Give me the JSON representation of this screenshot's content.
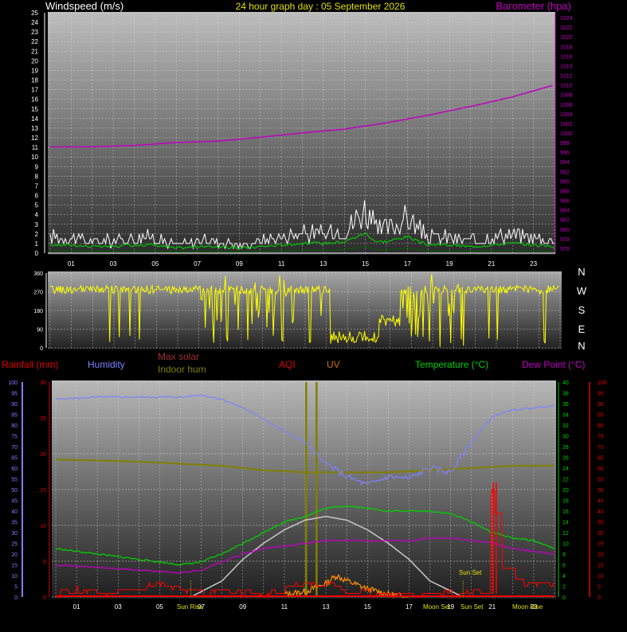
{
  "header": {
    "left_title": "Windspeed (m/s)",
    "center_title": "24 hour graph day : 05 September 2026",
    "right_title": "Barometer (hpa)"
  },
  "bottom_legend": {
    "rainfall": "Rainfall (mm)",
    "humidity": "Humidity",
    "max_solar": "Max solar",
    "indoor_hum": "Indoor hum",
    "aqi": "AQI",
    "uv": "UV",
    "temperature": "Temperature (°C)",
    "dew_point": "Dew Point (°C)"
  },
  "colors": {
    "windspeed": "#ffffff",
    "gust_avg": "#00c800",
    "barometer": "#c000c0",
    "direction": "#ffff00",
    "humidity": "#8080ff",
    "indoor_hum": "#808000",
    "temperature": "#00d000",
    "dew_point": "#c000c0",
    "rainfall": "#ff0000",
    "solar": "#ff9000",
    "max_solar": "#c8c8c8",
    "uv": "#808000"
  },
  "chart_data": [
    {
      "type": "line",
      "name": "wind_and_barometer",
      "x_ticks": [
        "01",
        "03",
        "05",
        "07",
        "09",
        "11",
        "13",
        "15",
        "17",
        "19",
        "21",
        "23"
      ],
      "y_left": {
        "label": "Windspeed (m/s)",
        "range": [
          0,
          25
        ],
        "ticks": [
          0,
          1,
          2,
          3,
          4,
          5,
          6,
          7,
          8,
          9,
          10,
          11,
          12,
          13,
          14,
          15,
          16,
          17,
          18,
          19,
          20,
          21,
          22,
          23,
          24,
          25
        ]
      },
      "y_right": {
        "label": "Barometer (hpa)",
        "range": [
          975,
          1025
        ],
        "ticks": [
          976,
          978,
          980,
          982,
          984,
          986,
          988,
          990,
          992,
          994,
          996,
          998,
          1000,
          1002,
          1004,
          1006,
          1008,
          1010,
          1012,
          1014,
          1016,
          1018,
          1020,
          1022,
          1024
        ]
      },
      "series": [
        {
          "name": "Barometer (hpa)",
          "x": [
            0,
            2,
            4,
            6,
            8,
            10,
            12,
            14,
            16,
            18,
            20,
            22,
            24
          ],
          "values": [
            997.1,
            997.1,
            997.4,
            998.0,
            998.3,
            999.1,
            1000.0,
            1000.8,
            1002.1,
            1003.7,
            1005.5,
            1007.5,
            1010.0
          ]
        },
        {
          "name": "Windspeed (m/s)",
          "x": [
            0,
            1,
            2,
            3,
            4,
            5,
            6,
            7,
            8,
            9,
            10,
            11,
            12,
            13,
            14,
            15,
            15.5,
            16,
            17,
            17.5,
            18,
            19,
            20,
            21,
            22,
            23,
            24
          ],
          "values": [
            2,
            2,
            1.5,
            1.5,
            2,
            2,
            1,
            1.5,
            1.5,
            1,
            1.5,
            2,
            2.5,
            2.5,
            3,
            5.5,
            3,
            3,
            4.5,
            3,
            2,
            2,
            1.5,
            2,
            2.5,
            2,
            1.5
          ]
        }
      ]
    },
    {
      "type": "line",
      "name": "wind_direction",
      "y_ticks": [
        0,
        90,
        180,
        270,
        360
      ],
      "compass_labels": [
        "N",
        "W",
        "S",
        "E",
        "N"
      ]
    },
    {
      "type": "line",
      "name": "temperature_humidity",
      "x_ticks": [
        "01",
        "03",
        "05",
        "07",
        "09",
        "11",
        "13",
        "15",
        "17",
        "19",
        "21",
        "23"
      ],
      "y_left_outer": {
        "label": "Humidity",
        "range": [
          0,
          100
        ],
        "ticks": [
          0,
          5,
          10,
          15,
          20,
          25,
          30,
          35,
          40,
          45,
          50,
          55,
          60,
          65,
          70,
          75,
          80,
          85,
          90,
          95,
          100
        ]
      },
      "y_left_inner": {
        "label": "Rainfall (mm)",
        "range": [
          0,
          30
        ],
        "ticks": [
          0,
          5,
          10,
          15,
          20,
          25,
          30
        ]
      },
      "y_right_inner": {
        "label": "Temperature (°C)",
        "range": [
          0,
          40
        ],
        "ticks": [
          0,
          2,
          4,
          6,
          8,
          10,
          12,
          14,
          16,
          18,
          20,
          22,
          24,
          26,
          28,
          30,
          32,
          34,
          36,
          38,
          40
        ]
      },
      "y_right_outer": {
        "label": "AQI",
        "range": [
          0,
          100
        ],
        "ticks": [
          0,
          5,
          10,
          15,
          20,
          25,
          30,
          35,
          40,
          45,
          50,
          55,
          60,
          65,
          70,
          75,
          80,
          85,
          90,
          95,
          100
        ]
      },
      "annotations": [
        "Sun Rise",
        "Sun Set",
        "Moon Set",
        "Moon Rise"
      ],
      "series": [
        {
          "name": "Humidity",
          "x": [
            0,
            2,
            4,
            6,
            7,
            8,
            9,
            10,
            11,
            12,
            13,
            14,
            15,
            16,
            17,
            18,
            19,
            20,
            21,
            22,
            23,
            24
          ],
          "values": [
            92,
            93,
            93,
            93,
            94,
            92,
            88,
            83,
            77,
            72,
            62,
            56,
            52,
            56,
            55,
            60,
            58,
            72,
            84,
            87,
            88,
            89
          ]
        },
        {
          "name": "Indoor hum",
          "x": [
            0,
            4,
            8,
            10,
            12,
            14,
            16,
            18,
            20,
            22,
            24
          ],
          "values": [
            64,
            63,
            61,
            59,
            58,
            58,
            58,
            59,
            60,
            61,
            61
          ]
        },
        {
          "name": "Temperature (°C)",
          "x": [
            0,
            2,
            4,
            6,
            7,
            8,
            9,
            10,
            11,
            12,
            13,
            14,
            15,
            16,
            17,
            18,
            19,
            20,
            21,
            22,
            23,
            24
          ],
          "values": [
            9,
            8,
            7,
            6,
            6.5,
            8,
            10,
            12,
            14,
            15,
            16.5,
            17,
            16.5,
            16,
            16,
            16,
            15.5,
            14,
            12,
            11,
            10.5,
            9
          ]
        },
        {
          "name": "Dew Point (°C)",
          "x": [
            0,
            2,
            4,
            6,
            7,
            8,
            9,
            10,
            11,
            12,
            13,
            14,
            15,
            16,
            17,
            18,
            19,
            20,
            21,
            22,
            23,
            24
          ],
          "values": [
            6,
            5.5,
            5,
            4.5,
            5,
            6.5,
            8,
            9,
            9.5,
            10,
            10.5,
            10.5,
            10.5,
            10.5,
            10.5,
            11,
            11,
            10.5,
            10,
            9,
            8.5,
            8
          ]
        },
        {
          "name": "Max solar",
          "x": [
            6.5,
            8,
            9,
            10,
            11,
            12,
            13,
            14,
            15,
            16,
            17,
            18,
            19.6
          ],
          "values": [
            0,
            3,
            7,
            10,
            12.5,
            14.3,
            15,
            14.3,
            12.5,
            10,
            7,
            3,
            0
          ]
        },
        {
          "name": "UV",
          "x": [
            12.0,
            12.1,
            12.1,
            12.5,
            12.5,
            12.6
          ],
          "values": [
            40,
            40,
            0,
            0,
            40,
            40
          ]
        },
        {
          "name": "Rainfall (mm)",
          "x": [
            0,
            1,
            2,
            3,
            4,
            5,
            6,
            7,
            8,
            9,
            10,
            11,
            12,
            13,
            14,
            15,
            16,
            17,
            18,
            19,
            20,
            20.5,
            21,
            21.5,
            22,
            23,
            24
          ],
          "values": [
            0.5,
            1,
            0.3,
            0.5,
            1,
            2,
            1,
            0.5,
            1,
            0.5,
            0.3,
            1,
            2,
            1.5,
            1,
            0.5,
            0.5,
            0.3,
            0.3,
            0.5,
            0.5,
            1,
            15,
            4,
            2,
            2,
            1.5
          ]
        },
        {
          "name": "Solar",
          "x": [
            11,
            12,
            13,
            13.5,
            14,
            15,
            15.5,
            16,
            17
          ],
          "values": [
            0.5,
            1,
            2.5,
            4,
            3,
            1.5,
            1,
            0.5,
            0
          ]
        }
      ]
    }
  ]
}
